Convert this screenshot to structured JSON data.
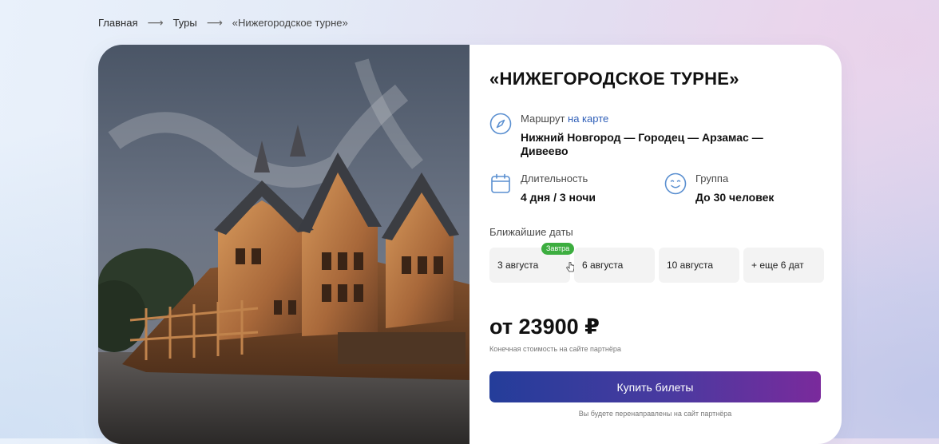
{
  "breadcrumb": {
    "home": "Главная",
    "tours": "Туры",
    "current": "«Нижегородское турне»",
    "separator": "⟶"
  },
  "tour": {
    "title": "«НИЖЕГОРОДСКОЕ ТУРНЕ»",
    "route_label": "Маршрут",
    "route_link": "на карте",
    "route_value": "Нижний Новгород — Городец — Арзамас — Дивеево",
    "duration_label": "Длительность",
    "duration_value": "4 дня / 3 ночи",
    "group_label": "Группа",
    "group_value": "До 30 человек"
  },
  "dates": {
    "label": "Ближайшие даты",
    "items": [
      "3 августа",
      "6 августа",
      "10 августа",
      "+ еще 6 дат"
    ],
    "badge": "Завтра"
  },
  "price": {
    "value": "от 23900 ₽",
    "note": "Конечная стоимость на сайте партнёра"
  },
  "buy": {
    "label": "Купить билеты",
    "note": "Вы будете перенаправлены на сайт партнёра"
  },
  "colors": {
    "accent_link": "#2f5fb8",
    "icon": "#5a8fd0",
    "badge": "#3cad3f",
    "button_start": "#243d9a",
    "button_end": "#7a2a9c"
  },
  "icons": {
    "route": "compass-icon",
    "duration": "calendar-icon",
    "group": "smile-icon"
  }
}
